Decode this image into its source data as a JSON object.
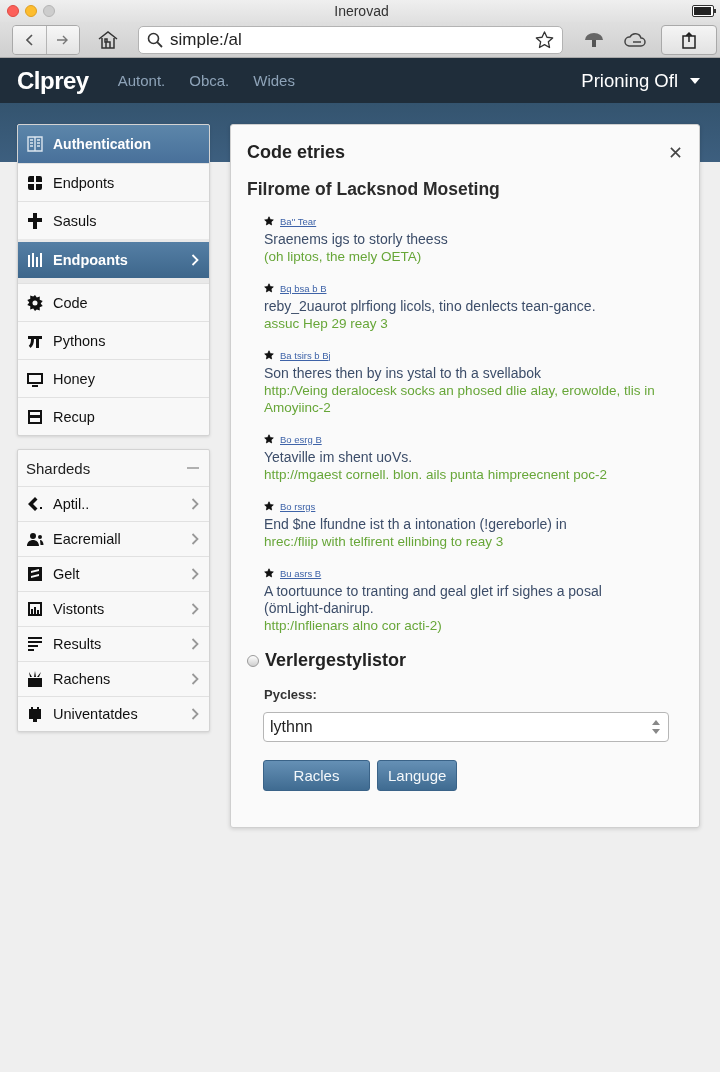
{
  "window": {
    "title": "Inerovad"
  },
  "toolbar": {
    "address": "simple:/al"
  },
  "navbar": {
    "logo": "Clprey",
    "links": [
      "Autont.",
      "Obca.",
      "Wides"
    ],
    "account": "Prioning Ofl"
  },
  "sidebar": {
    "groups": [
      {
        "kind": "banner",
        "title": "Authentication",
        "items": [
          {
            "label": "Endponts",
            "selected": false
          },
          {
            "label": "Sasuls",
            "selected": false
          },
          {
            "label": "Endpoants",
            "selected": true
          },
          {
            "label": "Code",
            "selected": false
          },
          {
            "label": "Pythons",
            "selected": false
          },
          {
            "label": "Honey",
            "selected": false
          },
          {
            "label": "Recup",
            "selected": false
          }
        ]
      },
      {
        "kind": "collapsible",
        "title": "Shardeds",
        "expanded": true,
        "items": [
          {
            "label": "Aptil..",
            "selected": false
          },
          {
            "label": "Eacremiall",
            "selected": false
          },
          {
            "label": "Gelt",
            "selected": false
          },
          {
            "label": "Vistonts",
            "selected": false
          },
          {
            "label": "Results",
            "selected": false
          },
          {
            "label": "Rachens",
            "selected": false
          },
          {
            "label": "Univentatdes",
            "selected": false
          }
        ]
      }
    ]
  },
  "dialog": {
    "title": "Code etries",
    "subtitle": "Filrome of Lacksnod Moseting",
    "entries": [
      {
        "starred": true,
        "link": "Ba'' Tear",
        "text": "Sraenems igs to storly theess",
        "url": "(oh liptos, the mely OETA)"
      },
      {
        "starred": true,
        "link": "Bq bsa b B",
        "text": "reby_2uaurot plrfiong licols, tino denlects tean-gance.",
        "url": "assuc Hep 29 reay 3"
      },
      {
        "starred": true,
        "link": "Ba tsirs b Bj",
        "text": "Son theres then by ins ystal to th a svellabok",
        "url": "http:/Veing deralocesk socks an phosed dlie alay, erowolde, tlis in Amoyiinc-2"
      },
      {
        "starred": true,
        "link": "Bo esrg B",
        "text": "Yetaville im shent uoVs.",
        "url": "http://mgaest cornell. blon. ails punta himpreecnent poc-2"
      },
      {
        "starred": true,
        "link": "Bo rsrgs",
        "text": "End $ne lfundne ist th a intonation (!gereborle) in",
        "url": "hrec:/fliip with telfirent ellinbing to reay 3"
      },
      {
        "starred": true,
        "link": "Bu asrs B",
        "text": "A toortuunce to tranting and geal glet irf sighes a posal (ömLight-danirup.",
        "url": "http:/Inflienars alno cor acti-2)"
      }
    ],
    "option": {
      "label": "Verlergestylistor",
      "checked": false
    },
    "field": {
      "label": "Pycless:",
      "value": "lythnn"
    },
    "buttons": [
      "Racles",
      "Languge"
    ]
  }
}
